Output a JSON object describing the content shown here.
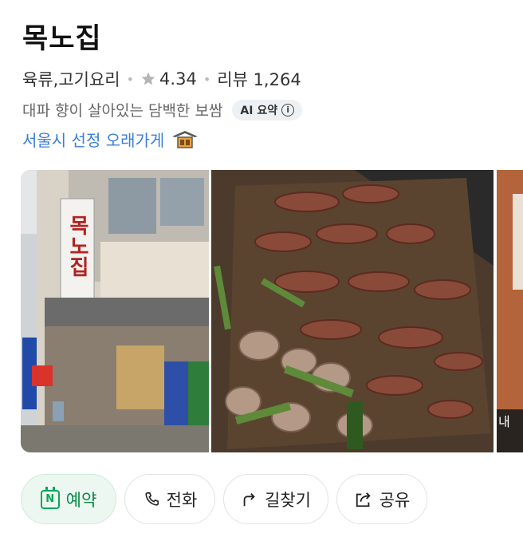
{
  "place": {
    "name": "목노집",
    "category": "육류,고기요리",
    "rating": "4.34",
    "reviews": "리뷰 1,264",
    "summary": "대파 향이 살아있는 담백한 보쌈",
    "ai_badge": "AI 요약",
    "featured": "서울시 선정 오래가게"
  },
  "photos": {
    "items": [
      "storefront-photo",
      "grilled-intestine-photo",
      "interior-photo"
    ],
    "sign_text": "목노집",
    "third_overlay_text": "내"
  },
  "actions": [
    {
      "label": "예약",
      "icon": "calendar-n-icon"
    },
    {
      "label": "전화",
      "icon": "phone-icon"
    },
    {
      "label": "길찾기",
      "icon": "directions-icon"
    },
    {
      "label": "공유",
      "icon": "share-icon"
    }
  ],
  "colors": {
    "accent_blue": "#3b7ed8",
    "reserve_green": "#0a8a47",
    "star_gray": "#b5b5b5"
  }
}
